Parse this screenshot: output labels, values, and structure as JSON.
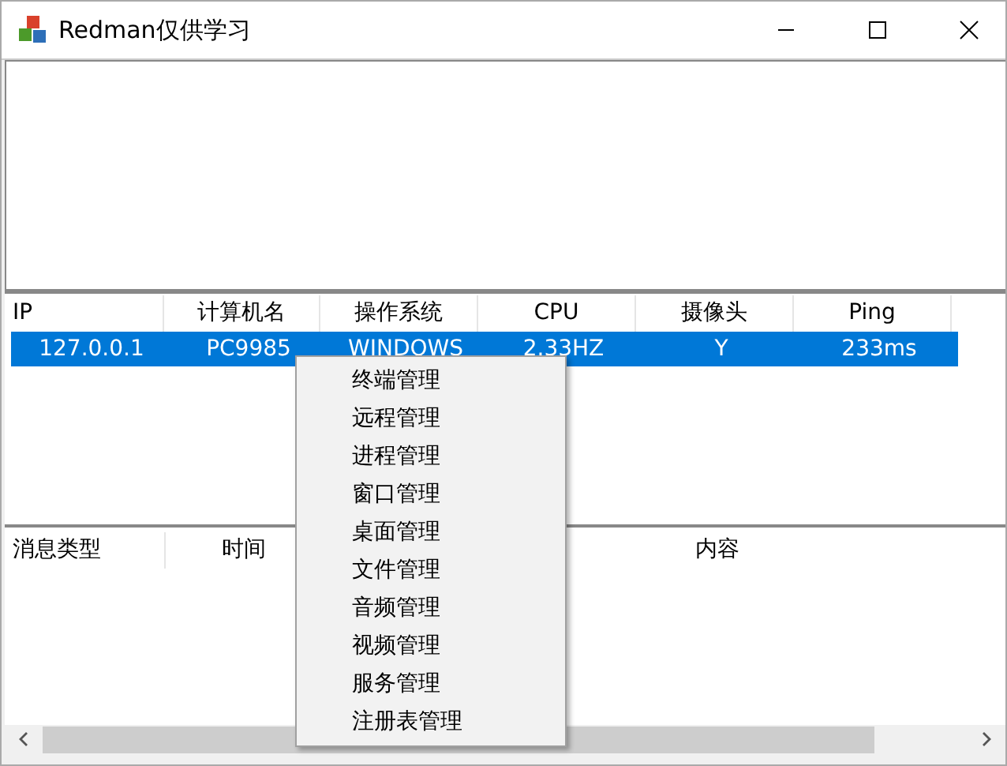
{
  "window": {
    "title": "Redman仅供学习"
  },
  "clients": {
    "columns": [
      "IP",
      "计算机名",
      "操作系统",
      "CPU",
      "摄像头",
      "Ping"
    ],
    "rows": [
      {
        "selected": true,
        "cells": [
          "127.0.0.1",
          "PC9985",
          "WINDOWS",
          "2.33HZ",
          "Y",
          "233ms"
        ]
      }
    ]
  },
  "log": {
    "columns": [
      "消息类型",
      "时间",
      "内容"
    ]
  },
  "context_menu": {
    "items": [
      "终端管理",
      "远程管理",
      "进程管理",
      "窗口管理",
      "桌面管理",
      "文件管理",
      "音频管理",
      "视频管理",
      "服务管理",
      "注册表管理"
    ]
  }
}
